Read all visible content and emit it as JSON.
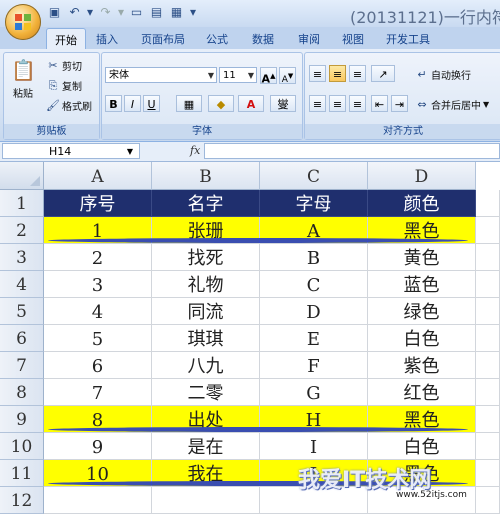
{
  "window": {
    "title": "(20131121)一行内符"
  },
  "tabs": [
    "开始",
    "插入",
    "页面布局",
    "公式",
    "数据",
    "审阅",
    "视图",
    "开发工具"
  ],
  "clipboard": {
    "paste": "粘贴",
    "cut": "剪切",
    "copy": "复制",
    "format_painter": "格式刷",
    "label": "剪贴板"
  },
  "font": {
    "name": "宋体",
    "size": "11",
    "bold": "B",
    "italic": "I",
    "underline": "U",
    "phonetic": "燮",
    "font_color": "A",
    "label": "字体"
  },
  "alignment": {
    "wrap_text": "自动换行",
    "merge_center": "合并后居中",
    "label": "对齐方式"
  },
  "formula_bar": {
    "name_box": "H14",
    "fx": "fx",
    "value": ""
  },
  "sheet": {
    "columns": [
      "A",
      "B",
      "C",
      "D"
    ],
    "rows": [
      "1",
      "2",
      "3",
      "4",
      "5",
      "6",
      "7",
      "8",
      "9",
      "10",
      "11",
      "12"
    ],
    "header": [
      "序号",
      "名字",
      "字母",
      "颜色"
    ],
    "data": [
      [
        "1",
        "张珊",
        "A",
        "黑色"
      ],
      [
        "2",
        "找死",
        "B",
        "黄色"
      ],
      [
        "3",
        "礼物",
        "C",
        "蓝色"
      ],
      [
        "4",
        "同流",
        "D",
        "绿色"
      ],
      [
        "5",
        "琪琪",
        "E",
        "白色"
      ],
      [
        "6",
        "八九",
        "F",
        "紫色"
      ],
      [
        "7",
        "二零",
        "G",
        "红色"
      ],
      [
        "8",
        "出处",
        "H",
        "黑色"
      ],
      [
        "9",
        "是在",
        "I",
        "白色"
      ],
      [
        "10",
        "我在",
        "J",
        "黑色"
      ]
    ],
    "highlighted_rows": [
      0,
      7,
      9
    ],
    "header_color": "#1f2f6e",
    "highlight_color": "#ffff00"
  },
  "watermark": {
    "text": "我爱IT技术网",
    "url": "www.52itjs.com"
  }
}
